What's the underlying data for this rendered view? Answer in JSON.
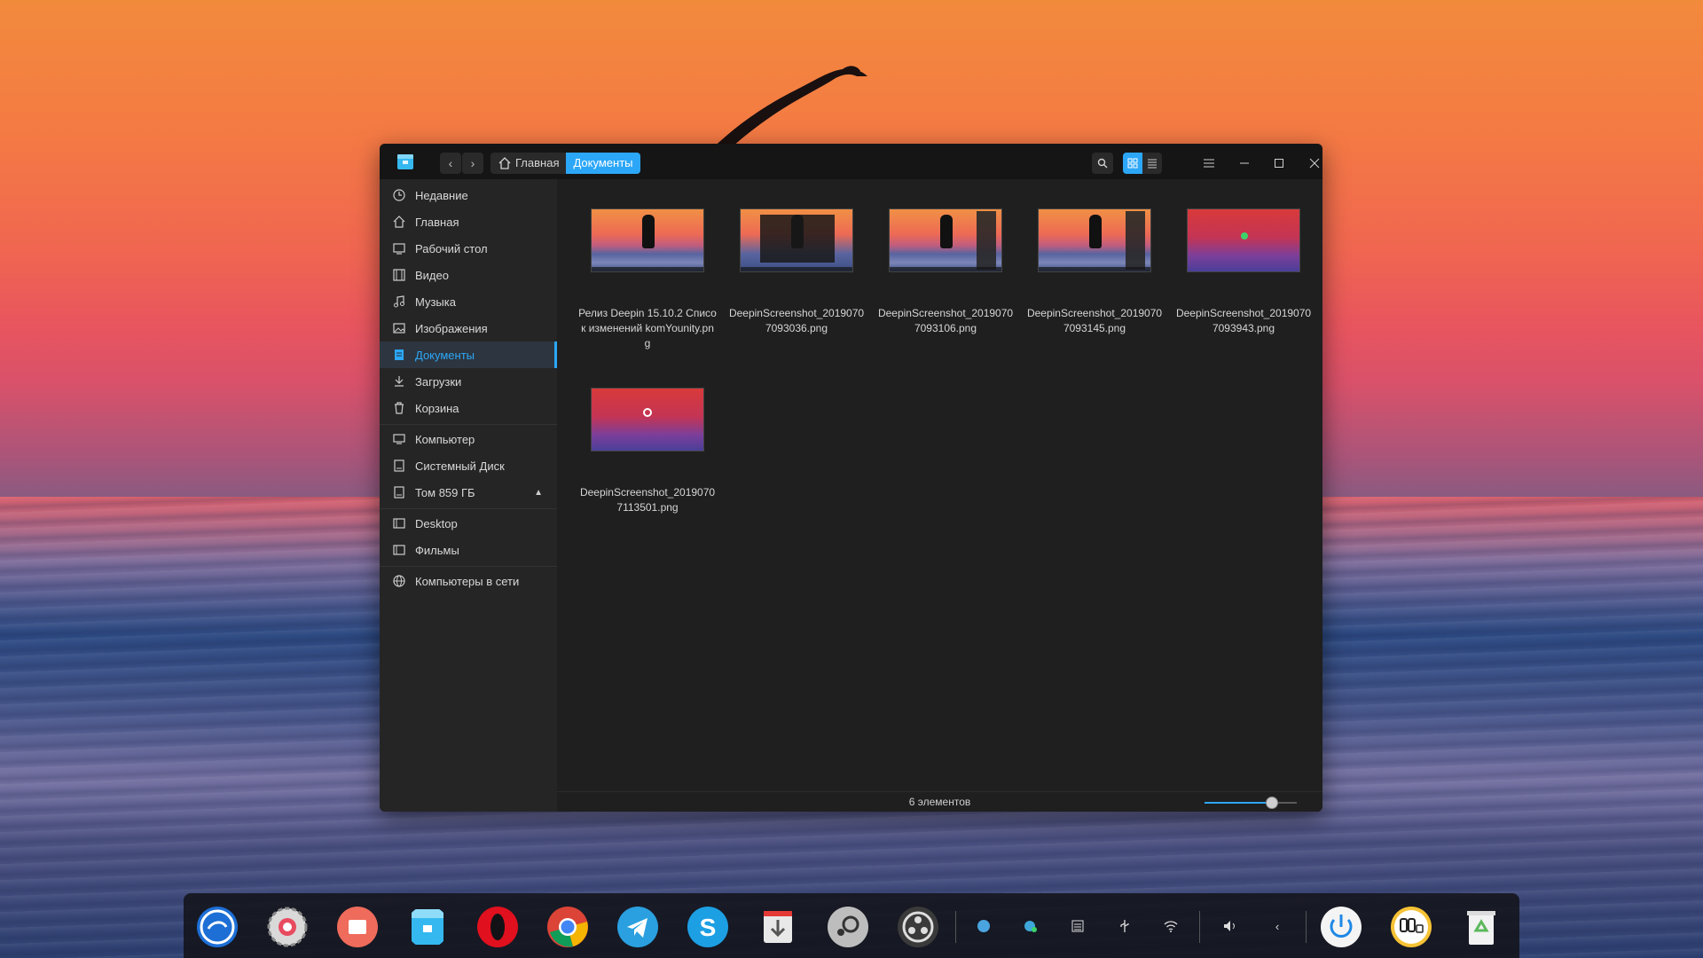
{
  "window": {
    "breadcrumb": [
      {
        "label": "Главная"
      },
      {
        "label": "Документы"
      }
    ]
  },
  "sidebar": {
    "items": [
      {
        "label": "Недавние",
        "icon": "clock-icon"
      },
      {
        "label": "Главная",
        "icon": "home-icon"
      },
      {
        "label": "Рабочий стол",
        "icon": "desktop-icon"
      },
      {
        "label": "Видео",
        "icon": "video-icon"
      },
      {
        "label": "Музыка",
        "icon": "music-icon"
      },
      {
        "label": "Изображения",
        "icon": "image-icon"
      },
      {
        "label": "Документы",
        "icon": "document-icon",
        "active": true
      },
      {
        "label": "Загрузки",
        "icon": "download-icon"
      },
      {
        "label": "Корзина",
        "icon": "trash-icon"
      },
      {
        "label": "Компьютер",
        "icon": "computer-icon"
      },
      {
        "label": "Системный Диск",
        "icon": "disk-icon"
      },
      {
        "label": "Том 859 ГБ",
        "icon": "disk-icon"
      },
      {
        "label": "Desktop",
        "icon": "folder-icon"
      },
      {
        "label": "Фильмы",
        "icon": "folder-icon"
      },
      {
        "label": "Компьютеры в сети",
        "icon": "network-icon"
      }
    ]
  },
  "files": [
    {
      "name": "Релиз Deepin 15.10.2 Список изменений komYounity.png"
    },
    {
      "name": "DeepinScreenshot_20190707093036.png"
    },
    {
      "name": "DeepinScreenshot_20190707093106.png"
    },
    {
      "name": "DeepinScreenshot_20190707093145.png"
    },
    {
      "name": "DeepinScreenshot_20190707093943.png"
    },
    {
      "name": "DeepinScreenshot_20190707113501.png"
    }
  ],
  "status": {
    "item_count": "6 элементов",
    "zoom_level": 0.73
  },
  "colors": {
    "accent": "#2ca7f8",
    "window_bg": "#1f1f1f",
    "sidebar_bg": "#252525"
  },
  "dock": {
    "apps": [
      "deepin-launcher-icon",
      "settings-icon",
      "screen-recorder-icon",
      "file-manager-icon",
      "opera-icon",
      "chrome-icon",
      "telegram-icon",
      "skype-icon",
      "installer-icon",
      "steam-icon",
      "obs-icon"
    ],
    "tray": [
      "network-status-icon",
      "vpn-icon",
      "keyboard-icon",
      "usb-icon",
      "wifi-icon",
      "volume-icon",
      "collapse-icon"
    ],
    "right": [
      "power-icon",
      "clock-widget-icon",
      "trash-icon"
    ]
  }
}
